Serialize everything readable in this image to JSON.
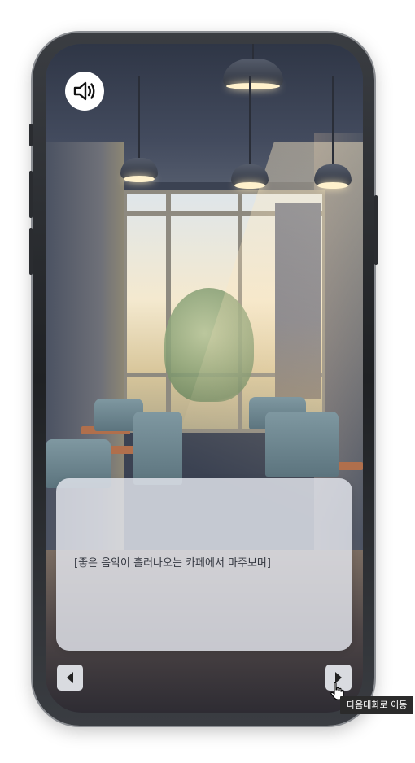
{
  "dialog": {
    "text": "[좋은 음악이 흘러나오는 카페에서 마주보며]"
  },
  "sound_button": {
    "icon": "speaker-icon"
  },
  "navigation": {
    "prev_icon": "triangle-left-icon",
    "next_icon": "triangle-right-icon",
    "next_tooltip": "다음대화로 이동"
  },
  "colors": {
    "dialog_background": "#e4e7ee",
    "button_background": "#d9dbe0",
    "tooltip_background": "#2b2b2b"
  }
}
